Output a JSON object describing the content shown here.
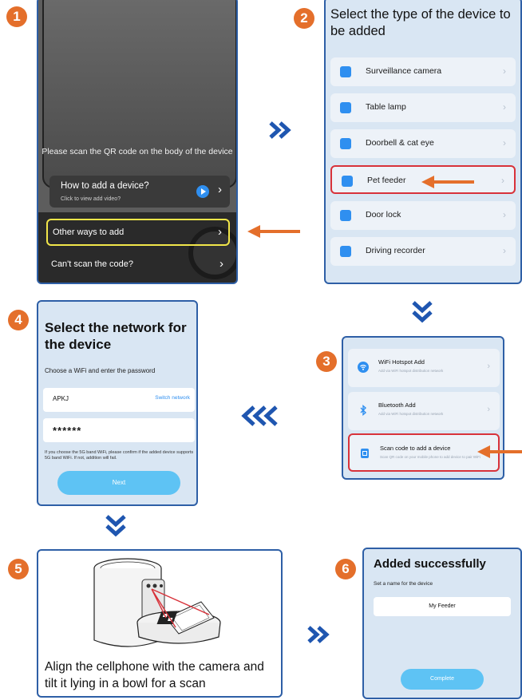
{
  "steps": [
    "1",
    "2",
    "3",
    "4",
    "5",
    "6"
  ],
  "step1": {
    "scan_text": "Please scan the QR code on the body of the device",
    "howto_title": "How to add a device?",
    "howto_sub": "Click to view add video?",
    "other_ways": "Other ways to add",
    "cant_scan": "Can't scan the code?"
  },
  "step2": {
    "title": "Select the type of the device to be added",
    "items": [
      {
        "label": "Surveillance camera",
        "icon": "camera-icon"
      },
      {
        "label": "Table lamp",
        "icon": "lamp-icon"
      },
      {
        "label": "Doorbell & cat eye",
        "icon": "doorbell-icon"
      },
      {
        "label": "Pet feeder",
        "icon": "feeder-icon"
      },
      {
        "label": "Door lock",
        "icon": "lock-icon"
      },
      {
        "label": "Driving recorder",
        "icon": "car-icon"
      }
    ]
  },
  "step3": {
    "items": [
      {
        "title": "WiFi Hotspot Add",
        "sub": "Add via WiFi hotspot distribution network"
      },
      {
        "title": "Bluetooth Add",
        "sub": "Add via WiFi hotspot distribution network"
      },
      {
        "title": "Scan code to add a device",
        "sub": "Scan QR code on your mobile phone to add device to pair WiFi"
      }
    ]
  },
  "step4": {
    "title": "Select the network for the device",
    "subtitle": "Choose a WiFi and enter the password",
    "wifi_name": "APKJ",
    "switch_network": "Switch network",
    "password_mask": "******",
    "note": "If you choose the 5G band WiFi, please confirm if the added device supports 5G band WiFi. If not, addition will fail.",
    "next": "Next"
  },
  "step5": {
    "caption": "Align the cellphone with the camera and tilt it lying in a bowl for a scan"
  },
  "step6": {
    "title": "Added successfully",
    "subtitle": "Set a name for the device",
    "device_name": "My Feeder",
    "complete": "Complete"
  },
  "colors": {
    "accent_orange": "#e46f2b",
    "frame_blue": "#2e5fa6",
    "highlight_red": "#d8323a",
    "highlight_yellow": "#f1e64a",
    "button_blue": "#5ec3f4",
    "panel_bg": "#d9e6f3"
  }
}
